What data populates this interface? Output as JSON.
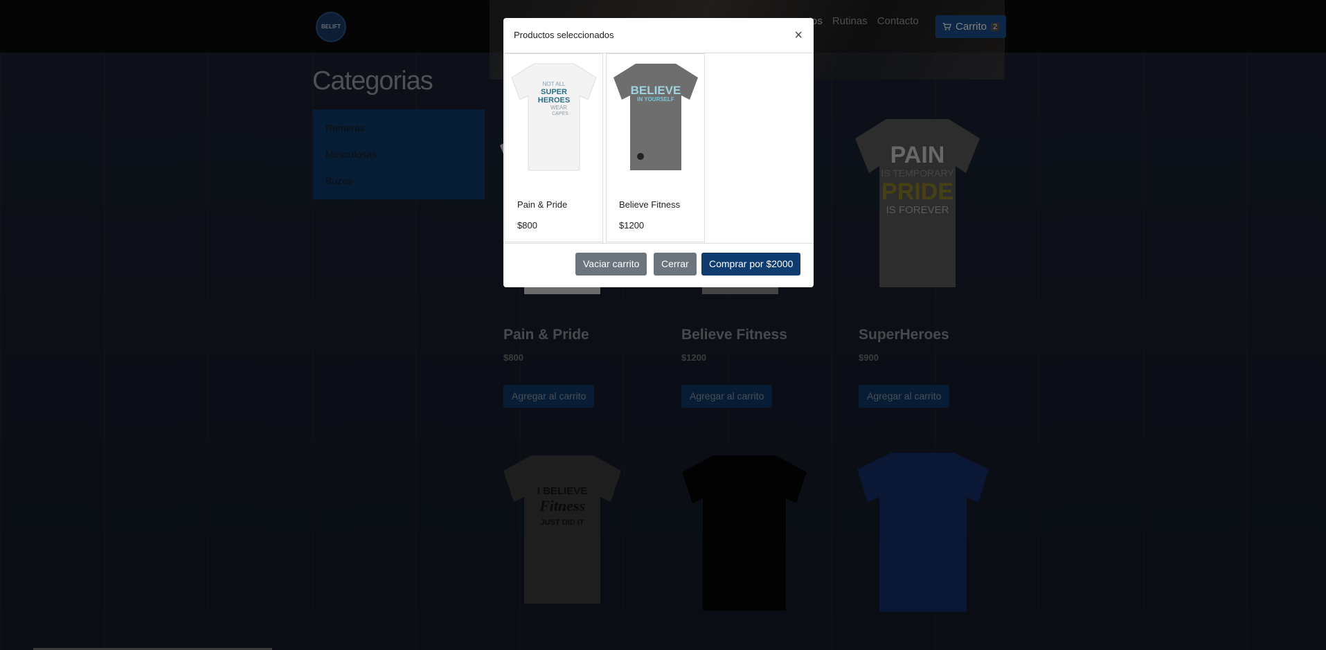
{
  "nav": {
    "logo_text": "BELIFT",
    "links": [
      "uctos",
      "Rutinas",
      "Contacto"
    ],
    "cart_label": "Carrito",
    "cart_count": "2"
  },
  "sidebar": {
    "title": "Categorias",
    "items": [
      "Remeras",
      "Musculosas",
      "Buzos"
    ]
  },
  "products": [
    {
      "name": "Pain & Pride",
      "price": "$800",
      "button": "Agregar al carrito"
    },
    {
      "name": "Believe Fitness",
      "price": "$1200",
      "button": "Agregar al carrito"
    },
    {
      "name": "SuperHeroes",
      "price": "$900",
      "button": "Agregar al carrito"
    }
  ],
  "tshirt_art": {
    "pain": [
      "PAIN",
      "IS TEMPORARY",
      "PRIDE",
      "IS FOREVER"
    ],
    "fitness": [
      "I BELIEVE",
      "Fitness",
      "JUST DID IT"
    ],
    "superheroes": [
      "NOT ALL",
      "SUPER",
      "HEROES",
      "WEAR",
      "CAPES"
    ],
    "believe": [
      "BELIEVE",
      "IN YOURSELF"
    ]
  },
  "modal": {
    "title": "Productos seleccionados",
    "close": "×",
    "items": [
      {
        "name": "Pain & Pride",
        "price": "$800"
      },
      {
        "name": "Believe Fitness",
        "price": "$1200"
      }
    ],
    "buttons": {
      "empty": "Vaciar carrito",
      "close": "Cerrar",
      "buy": "Comprar por $2000"
    }
  }
}
